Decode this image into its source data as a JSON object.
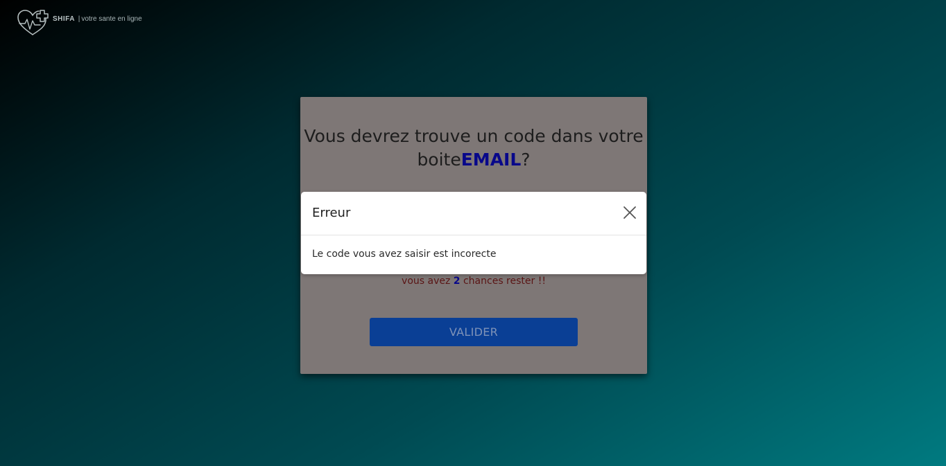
{
  "logo": {
    "brand": "SHIFA",
    "separator": "|",
    "tagline": "votre sante en ligne",
    "icon": "heart-pulse-cross-icon"
  },
  "card": {
    "title_prefix": "Vous devrez trouve un code dans votre boite",
    "title_highlight": "EMAIL",
    "title_suffix": "?",
    "chances_prefix": "vous avez",
    "chances_count": "2",
    "chances_suffix": "chances rester !!",
    "validate_label": "VALIDER"
  },
  "modal": {
    "title": "Erreur",
    "message": "Le code vous avez saisir est incorecte",
    "close_icon": "close-icon"
  },
  "colors": {
    "card_bg": "#7e7776",
    "highlight": "#08088a",
    "button_bg": "#0a3f95"
  }
}
